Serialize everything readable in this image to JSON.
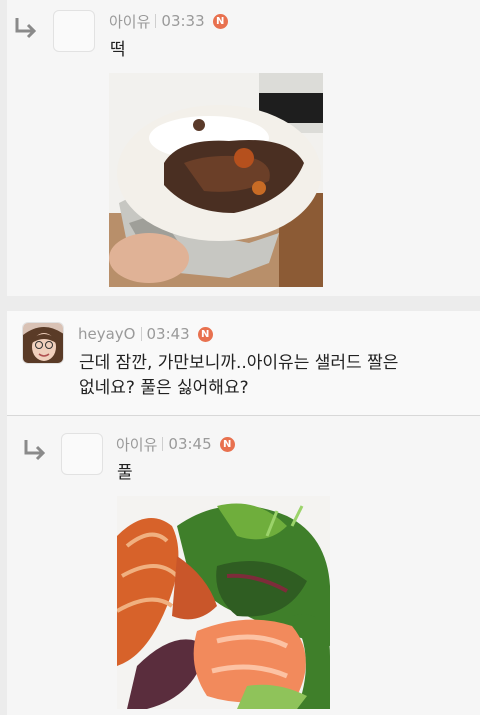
{
  "comments": [
    {
      "type": "reply",
      "author": "아이유",
      "time": "03:33",
      "badge": "N",
      "text": "떡",
      "photo_subject": "bun"
    },
    {
      "type": "comment",
      "author": "heyayO",
      "time": "03:43",
      "badge": "N",
      "text_line1": "근데 잠깐, 가만보니까..아이유는 샐러드 짤은",
      "text_line2": "없네요? 풀은 싫어해요?"
    },
    {
      "type": "reply",
      "author": "아이유",
      "time": "03:45",
      "badge": "N",
      "text": "풀",
      "photo_subject": "salad"
    }
  ],
  "colors": {
    "badge": "#e8714f",
    "meta_text": "#9a9a9a",
    "body_text": "#222222"
  }
}
